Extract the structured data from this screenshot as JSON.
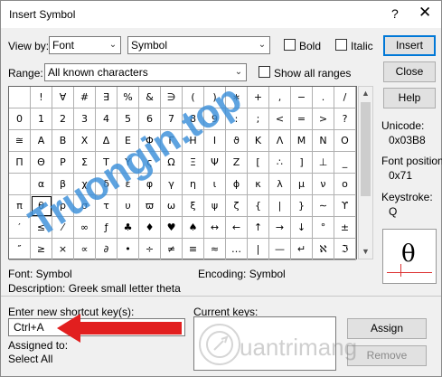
{
  "window": {
    "title": "Insert Symbol",
    "help_glyph": "?",
    "close_glyph": "✕"
  },
  "top": {
    "view_by_label": "View by:",
    "view_by_value": "Font",
    "font_value": "Symbol",
    "bold_label": "Bold",
    "italic_label": "Italic",
    "range_label": "Range:",
    "range_value": "All known characters",
    "show_all_label": "Show all ranges"
  },
  "buttons": {
    "insert": "Insert",
    "close": "Close",
    "help": "Help",
    "assign": "Assign",
    "remove": "Remove"
  },
  "grid_rows": [
    [
      "",
      "!",
      "∀",
      "#",
      "∃",
      "%",
      "&",
      "∋",
      "(",
      ")",
      "∗",
      "+",
      ",",
      "−",
      ".",
      "/"
    ],
    [
      "0",
      "1",
      "2",
      "3",
      "4",
      "5",
      "6",
      "7",
      "8",
      "9",
      ":",
      ";",
      "<",
      "=",
      ">",
      "?"
    ],
    [
      "≅",
      "Α",
      "Β",
      "Χ",
      "Δ",
      "Ε",
      "Φ",
      "Γ",
      "Η",
      "Ι",
      "ϑ",
      "Κ",
      "Λ",
      "Μ",
      "Ν",
      "Ο"
    ],
    [
      "Π",
      "Θ",
      "Ρ",
      "Σ",
      "Τ",
      "Υ",
      "ς",
      "Ω",
      "Ξ",
      "Ψ",
      "Ζ",
      "[",
      "∴",
      "]",
      "⊥",
      "_"
    ],
    [
      "",
      "α",
      "β",
      "χ",
      "δ",
      "ε",
      "φ",
      "γ",
      "η",
      "ι",
      "ϕ",
      "κ",
      "λ",
      "μ",
      "ν",
      "ο"
    ],
    [
      "π",
      "θ",
      "ρ",
      "σ",
      "τ",
      "υ",
      "ϖ",
      "ω",
      "ξ",
      "ψ",
      "ζ",
      "{",
      "|",
      "}",
      "∼",
      "ϒ"
    ],
    [
      "′",
      "≤",
      "⁄",
      "∞",
      "ƒ",
      "♣",
      "♦",
      "♥",
      "♠",
      "↔",
      "←",
      "↑",
      "→",
      "↓",
      "°",
      "±"
    ],
    [
      "″",
      "≥",
      "×",
      "∝",
      "∂",
      "•",
      "÷",
      "≠",
      "≡",
      "≈",
      "…",
      "|",
      "—",
      "↵",
      "ℵ",
      "ℑ"
    ]
  ],
  "info": {
    "unicode_label": "Unicode:",
    "unicode_value": "0x03B8",
    "font_position_label": "Font position:",
    "font_position_value": "0x71",
    "keystroke_label": "Keystroke:",
    "keystroke_value": "Q",
    "preview_char": "θ",
    "font_line": "Font: Symbol",
    "encoding_line": "Encoding: Symbol",
    "description_line": "Description: Greek small letter theta"
  },
  "shortcut": {
    "enter_label": "Enter new shortcut key(s):",
    "key_value": "Ctrl+A",
    "current_keys_label": "Current keys:",
    "assigned_to_label": "Assigned to:",
    "assigned_to_value": "Select All"
  },
  "watermarks": {
    "top": "Truongin.top",
    "bottom": "uantrimang"
  },
  "colors": {
    "arrow": "#e21f1f",
    "watermark_blue": "#3a8fd9",
    "accent": "#0078d7"
  }
}
